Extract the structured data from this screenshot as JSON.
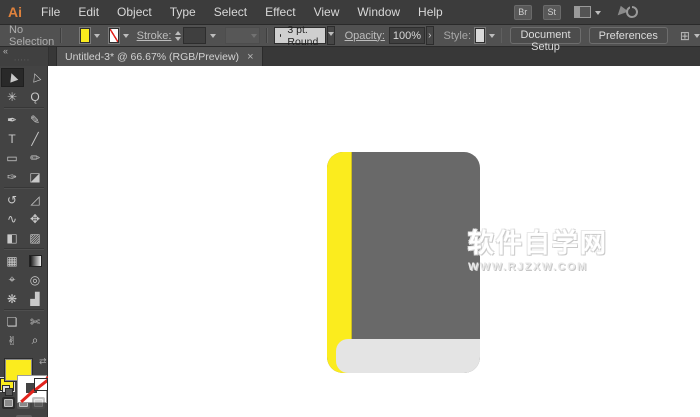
{
  "menubar": {
    "logo": "Ai",
    "items": [
      "File",
      "Edit",
      "Object",
      "Type",
      "Select",
      "Effect",
      "View",
      "Window",
      "Help"
    ],
    "br_button": "Br",
    "st_button": "St"
  },
  "controlbar": {
    "no_selection": "No Selection",
    "stroke_label": "Stroke:",
    "brush_value": "3 pt. Round",
    "opacity_label": "Opacity:",
    "opacity_value": "100%",
    "opacity_expand": "›",
    "style_label": "Style:",
    "document_setup": "Document Setup",
    "preferences": "Preferences",
    "align_icon": "⊞"
  },
  "tabbar": {
    "collapse": "«",
    "grip": "∙∙∙∙∙",
    "title": "Untitled-3* @ 66.67% (RGB/Preview)",
    "close": "×"
  },
  "toolbar": {
    "selected": "selection",
    "tools": [
      {
        "name": "selection",
        "glyph": "▶"
      },
      {
        "name": "direct-selection",
        "glyph": "▷"
      },
      {
        "name": "magic-wand",
        "glyph": "✳"
      },
      {
        "name": "lasso",
        "glyph": "Ǫ"
      },
      {
        "name": "pen",
        "glyph": "✒"
      },
      {
        "name": "paintbrush",
        "glyph": "✎"
      },
      {
        "name": "type",
        "glyph": "T"
      },
      {
        "name": "line-segment",
        "glyph": "╱"
      },
      {
        "name": "rectangle",
        "glyph": "▭"
      },
      {
        "name": "pencil",
        "glyph": "✏"
      },
      {
        "name": "blob-brush",
        "glyph": "✑"
      },
      {
        "name": "eraser",
        "glyph": "◪"
      },
      {
        "name": "rotate",
        "glyph": "↺"
      },
      {
        "name": "scale",
        "glyph": "◿"
      },
      {
        "name": "width",
        "glyph": "∿"
      },
      {
        "name": "free-transform",
        "glyph": "✥"
      },
      {
        "name": "shape-builder",
        "glyph": "◧"
      },
      {
        "name": "perspective-grid",
        "glyph": "▨"
      },
      {
        "name": "mesh",
        "glyph": "▦"
      },
      {
        "name": "gradient",
        "glyph": ""
      },
      {
        "name": "eyedropper",
        "glyph": "⌖"
      },
      {
        "name": "blend",
        "glyph": "◎"
      },
      {
        "name": "symbol-sprayer",
        "glyph": "❋"
      },
      {
        "name": "column-graph",
        "glyph": "▟"
      },
      {
        "name": "artboard",
        "glyph": "❏"
      },
      {
        "name": "slice",
        "glyph": "✄"
      },
      {
        "name": "hand",
        "glyph": "✌"
      },
      {
        "name": "zoom",
        "glyph": "⌕"
      }
    ],
    "modes": [
      {
        "name": "draw-normal",
        "active": true,
        "disabled": false
      },
      {
        "name": "draw-behind",
        "active": false,
        "disabled": false
      },
      {
        "name": "draw-inside",
        "active": false,
        "disabled": true
      }
    ]
  },
  "canvas": {
    "watermark_line1": "软件自学网",
    "watermark_line2": "WWW.RJZXW.COM"
  },
  "colors": {
    "accent_yellow": "#fbec1e",
    "book_gray": "#696969",
    "band_gray": "#e4e4e4",
    "stroke_none_red": "#e2241d",
    "canvas_white": "#ffffff",
    "ui_dark": "#3c3c3c",
    "ui_mid": "#515151"
  }
}
